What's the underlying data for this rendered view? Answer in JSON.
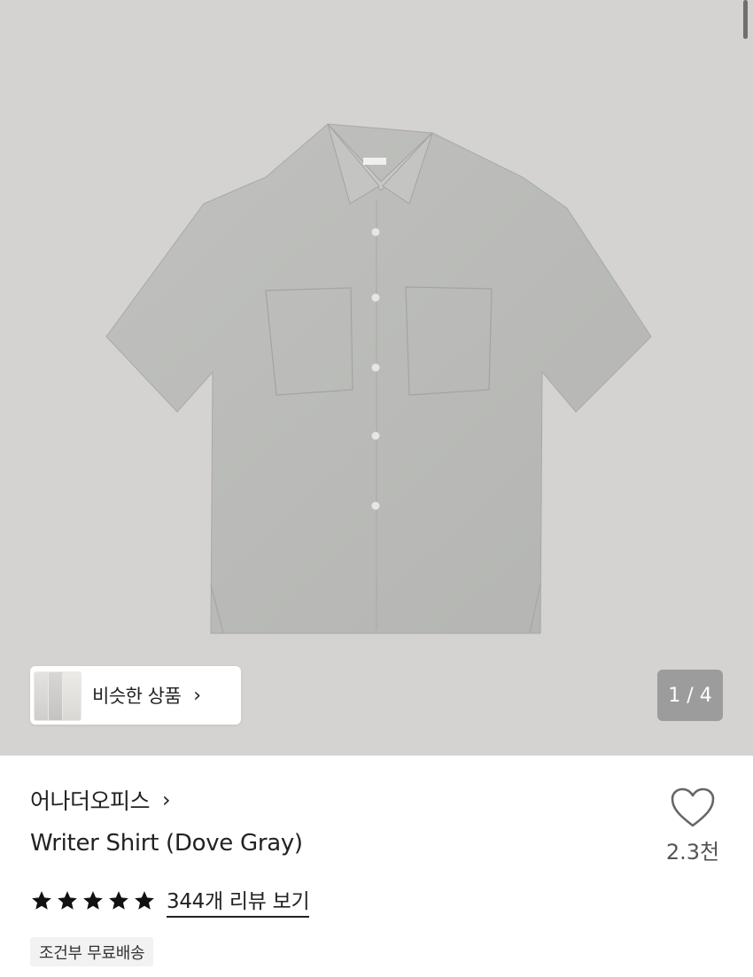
{
  "hero": {
    "image_alt": "Gray short-sleeve shirt",
    "similar_button_label": "비슷한 상품",
    "page_indicator": "1 / 4"
  },
  "product": {
    "brand": "어나더오피스",
    "name": "Writer Shirt (Dove Gray)",
    "rating": 5,
    "review_link": "344개 리뷰 보기",
    "shipping_badge": "조건부 무료배송",
    "like_count": "2.3천"
  },
  "colors": {
    "hero_bg": "#d4d3d1",
    "shirt": "#b9bab7",
    "indicator_bg": "#9c9c9c"
  },
  "icons": {
    "similar_chevron": "chevron-right-icon",
    "brand_chevron": "chevron-right-icon",
    "star": "star-icon",
    "like": "heart-outline-icon"
  }
}
